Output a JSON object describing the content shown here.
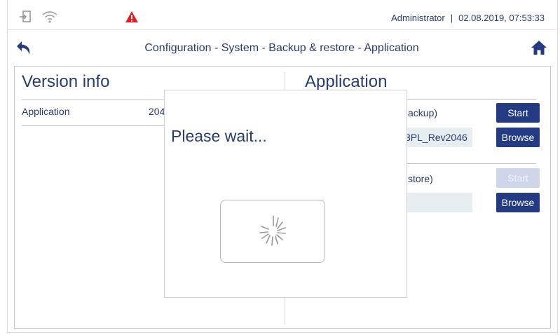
{
  "statusbar": {
    "user": "Administrator",
    "separator": "|",
    "datetime": "02.08.2019, 07:53:33",
    "icons": [
      "login-icon",
      "wifi-icon",
      "warning-icon"
    ],
    "warning_color": "#e31e24"
  },
  "navbar": {
    "title": "Configuration - System - Backup & restore - Application",
    "icons": [
      "back-arrow-icon",
      "home-icon"
    ]
  },
  "version_info": {
    "heading": "Version info",
    "rows": [
      {
        "label": "Application",
        "value": "204"
      }
    ]
  },
  "application": {
    "heading": "Application",
    "backup": {
      "label": "ackup)",
      "start_label": "Start",
      "browse_label": "Browse",
      "field_value": "3PL_Rev2046"
    },
    "restore": {
      "label": "store)",
      "start_label": "Start",
      "start_disabled": true,
      "browse_label": "Browse",
      "field_value": ""
    }
  },
  "modal": {
    "message": "Please wait..."
  },
  "colors": {
    "primary": "#243a82",
    "text": "#2a3b6e",
    "field_bg": "#e6eef2",
    "disabled_button": "#cfd6ea"
  }
}
